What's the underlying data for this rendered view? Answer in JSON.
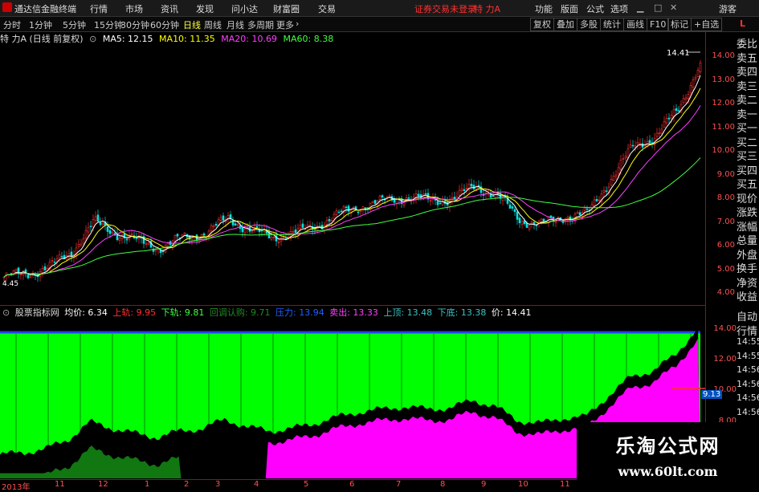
{
  "app": {
    "title": "通达信金融终端"
  },
  "menu": [
    "行情",
    "市场",
    "资讯",
    "发现",
    "问小达",
    "财富圈",
    "交易"
  ],
  "alert": {
    "text": "证券交易未登录",
    "stock": "特 力A"
  },
  "menu_right": [
    "功能",
    "版面",
    "公式",
    "选项"
  ],
  "guest": "游客",
  "periods": [
    "分时",
    "1分钟",
    "5分钟",
    "15分钟",
    "30分钟",
    "60分钟",
    "日线",
    "周线",
    "月线",
    "多周期",
    "更多"
  ],
  "active_period": "日线",
  "toolbar_right": [
    "复权",
    "叠加",
    "多股",
    "统计",
    "画线",
    "F10",
    "标记",
    "+自选"
  ],
  "right_corner": "L",
  "main_info": {
    "name": "特 力A (日线 前复权)",
    "ma5": "MA5: 12.15",
    "ma10": "MA10: 11.35",
    "ma20": "MA20: 10.69",
    "ma60": "MA60: 8.38"
  },
  "price_labels": {
    "high": "14.41",
    "low": "4.45"
  },
  "main_axis": [
    "14.00",
    "13.00",
    "12.00",
    "11.00",
    "10.00",
    "9.00",
    "8.00",
    "7.00",
    "6.00",
    "5.00",
    "4.00"
  ],
  "right_panel": [
    "委比",
    "卖五",
    "卖四",
    "卖三",
    "卖二",
    "卖一",
    "买一",
    "买二",
    "买三",
    "买四",
    "买五",
    "现价",
    "涨跌",
    "涨幅",
    "总量",
    "外盘",
    "换手",
    "净资",
    "收益"
  ],
  "ind_info": {
    "name": "股票指标网",
    "avg": "均价: 6.34",
    "up": "上轨: 9.95",
    "down": "下轨: 9.81",
    "mid": "回调认购: 9.71",
    "pressure": "压力: 13.94",
    "sell": "卖出: 13.33",
    "top": "上顶: 13.48",
    "bottom": "下底: 13.38",
    "price": "价: 14.41"
  },
  "ind_axis": [
    "14.00",
    "12.00",
    "10.00",
    "8.00"
  ],
  "ind_marker": "9.13",
  "right_panel2": [
    "自动",
    "行情",
    "14:55",
    "14:55",
    "14:56",
    "14:56",
    "14:56",
    "14:56",
    "14:56",
    "14:56",
    "14:56",
    "14:56"
  ],
  "date_axis": [
    "2013年",
    "11",
    "12",
    "1",
    "2",
    "3",
    "4",
    "5",
    "6",
    "7",
    "8",
    "9",
    "10",
    "11",
    "12"
  ],
  "watermark": {
    "title": "乐淘公式网",
    "url": "www.60lt.com"
  },
  "chart_data": {
    "type": "candlestick",
    "title": "特 力A (日线 前复权)",
    "ylim": [
      3.6,
      14.8
    ],
    "x": [
      "2013年",
      "11",
      "12",
      "1",
      "2",
      "3",
      "4",
      "5",
      "6",
      "7",
      "8",
      "9",
      "10",
      "11",
      "12"
    ],
    "close": [
      4.45,
      4.6,
      4.9,
      5.6,
      7.0,
      6.5,
      6.1,
      5.8,
      6.3,
      6.5,
      7.2,
      6.6,
      6.3,
      6.5,
      6.9,
      7.4,
      7.8,
      8.0,
      8.2,
      8.0,
      8.1,
      8.7,
      8.2,
      7.1,
      6.9,
      7.3,
      7.4,
      9.0,
      10.5,
      11.0,
      12.2,
      14.41
    ],
    "ma60_end": 8.38
  }
}
